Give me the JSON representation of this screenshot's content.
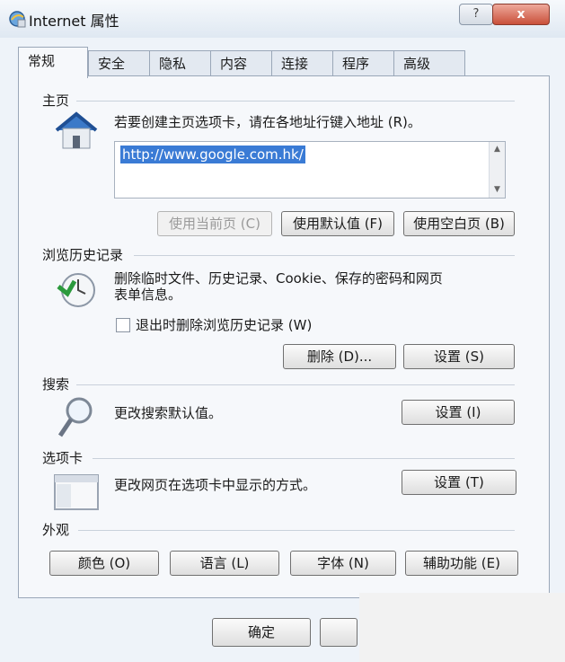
{
  "window": {
    "title": "Internet 属性",
    "help_label": "?",
    "close_label": "x"
  },
  "tabs": [
    {
      "label": "常规",
      "active": true
    },
    {
      "label": "安全"
    },
    {
      "label": "隐私"
    },
    {
      "label": "内容"
    },
    {
      "label": "连接"
    },
    {
      "label": "程序"
    },
    {
      "label": "高级"
    }
  ],
  "home": {
    "label": "主页",
    "description": "若要创建主页选项卡，请在各地址行键入地址 (R)。",
    "url": "http://www.google.com.hk/",
    "buttons": {
      "use_current": "使用当前页 (C)",
      "use_default": "使用默认值 (F)",
      "use_blank": "使用空白页 (B)"
    }
  },
  "history": {
    "label": "浏览历史记录",
    "description_line1": "删除临时文件、历史记录、Cookie、保存的密码和网页",
    "description_line2": "表单信息。",
    "checkbox_label": "退出时删除浏览历史记录 (W)",
    "checkbox_checked": false,
    "delete_label": "删除 (D)...",
    "settings_label": "设置 (S)"
  },
  "search": {
    "label": "搜索",
    "description": "更改搜索默认值。",
    "settings_label": "设置 (I)"
  },
  "tabs_section": {
    "label": "选项卡",
    "description": "更改网页在选项卡中显示的方式。",
    "settings_label": "设置 (T)"
  },
  "appearance": {
    "label": "外观",
    "colors_label": "颜色 (O)",
    "languages_label": "语言 (L)",
    "fonts_label": "字体 (N)",
    "accessibility_label": "辅助功能 (E)"
  },
  "footer": {
    "ok_label": "确定"
  }
}
